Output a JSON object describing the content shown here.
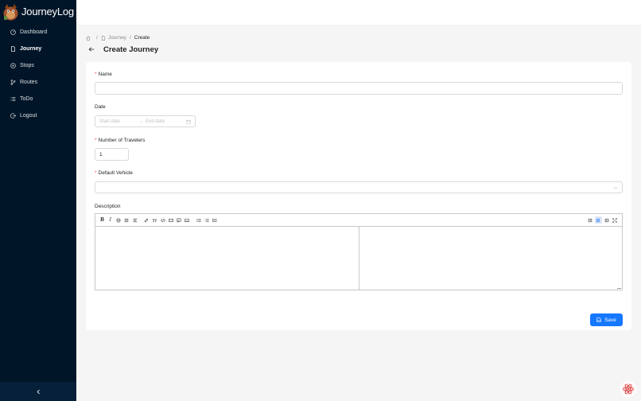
{
  "app": {
    "title": "JourneyLog"
  },
  "sidebar": {
    "items": [
      {
        "label": "Dashboard",
        "icon": "dashboard-icon",
        "active": false
      },
      {
        "label": "Journey",
        "icon": "file-icon",
        "active": true
      },
      {
        "label": "Stops",
        "icon": "location-icon",
        "active": false
      },
      {
        "label": "Routes",
        "icon": "branches-icon",
        "active": false
      },
      {
        "label": "ToDo",
        "icon": "list-icon",
        "active": false
      },
      {
        "label": "Logout",
        "icon": "logout-icon",
        "active": false
      }
    ],
    "collapse_icon": "chevron-left-icon"
  },
  "breadcrumb": {
    "home_icon": "home-icon",
    "items": [
      "Journey",
      "Create"
    ],
    "separator": "/"
  },
  "page": {
    "title": "Create Journey"
  },
  "form": {
    "name": {
      "label": "Name",
      "required": true,
      "value": ""
    },
    "date": {
      "label": "Date",
      "start_placeholder": "Start date",
      "end_placeholder": "End date",
      "arrow": "→"
    },
    "travelers": {
      "label": "Number of Travelers",
      "required": true,
      "value": "1"
    },
    "vehicle": {
      "label": "Default Vehicle",
      "required": true,
      "value": ""
    },
    "description": {
      "label": "Description"
    }
  },
  "actions": {
    "save_label": "Save"
  },
  "colors": {
    "sidebar_bg": "#011528",
    "primary": "#1677ff",
    "required": "#ff4d4f"
  }
}
